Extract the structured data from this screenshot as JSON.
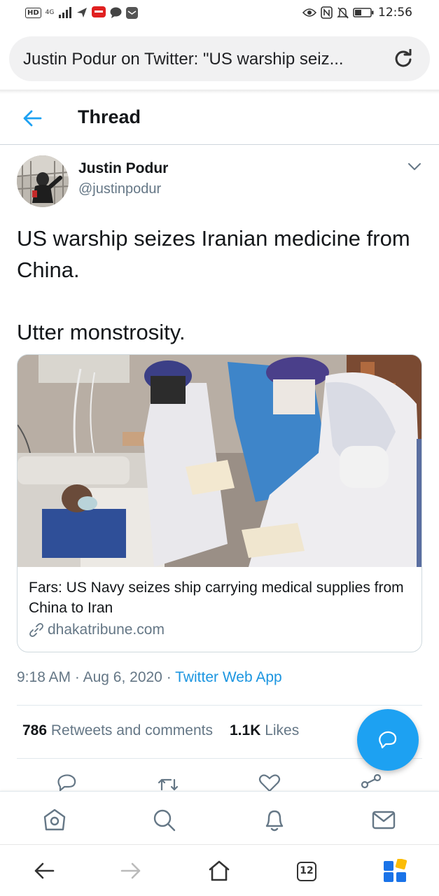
{
  "status_bar": {
    "hd_label": "HD",
    "network_label": "4G",
    "time": "12:56"
  },
  "browser": {
    "url_title": "Justin Podur on Twitter: \"US warship seiz...",
    "tabs_count": "12"
  },
  "header": {
    "title": "Thread"
  },
  "tweet": {
    "author_name": "Justin Podur",
    "author_handle": "@justinpodur",
    "text_line1": "US warship seizes Iranian medicine from China.",
    "text_line2": "Utter monstrosity.",
    "card": {
      "title": "Fars: US Navy seizes ship carrying medical supplies from China to Iran",
      "domain": "dhakatribune.com"
    },
    "time": "9:18 AM",
    "date": "Aug 6, 2020",
    "separator": "·",
    "source_app": "Twitter Web App",
    "retweets_count": "786",
    "retweets_label": "Retweets and comments",
    "likes_count": "1.1K",
    "likes_label": "Likes"
  },
  "colors": {
    "twitter_blue": "#1da1f2",
    "link_blue": "#1b95e0",
    "secondary_text": "#657786"
  },
  "icons": {
    "back": "back-arrow-icon",
    "caret": "chevron-down-icon",
    "reload": "reload-icon",
    "fab": "compose-reply-icon"
  }
}
